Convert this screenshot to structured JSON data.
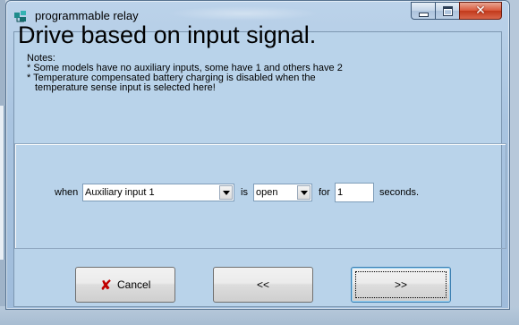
{
  "window": {
    "title": "programmable relay",
    "minimize_label": "",
    "maximize_label": "",
    "close_label": "✕"
  },
  "main": {
    "heading": "Drive based on input signal.",
    "notes": [
      "Notes:",
      "* Some models have no auxiliary inputs, some have 1 and others have 2",
      "* Temperature compensated battery charging is disabled when the",
      "temperature sense input is selected here!"
    ]
  },
  "condition": {
    "when_label": "when",
    "input_select": "Auxiliary input 1",
    "is_label": "is",
    "state_select": "open",
    "for_label": "for",
    "duration_value": "1",
    "seconds_label": "seconds."
  },
  "buttons": {
    "cancel": "Cancel",
    "back": "<<",
    "next": ">>"
  },
  "colors": {
    "client_bg": "#b9d3ea",
    "cancel_icon": "#c00000"
  }
}
